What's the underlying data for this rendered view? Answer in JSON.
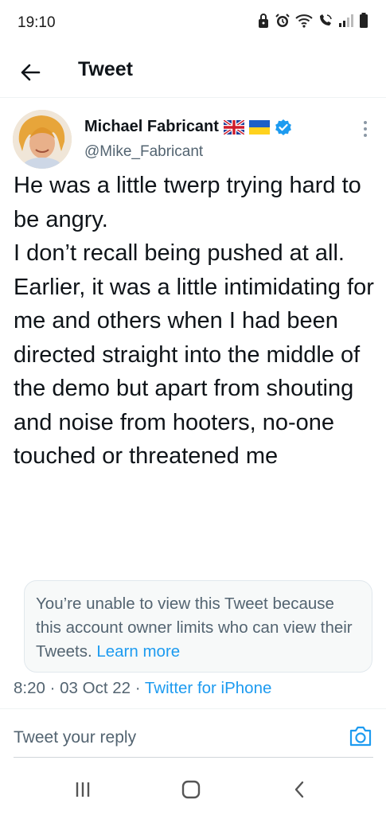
{
  "status_bar": {
    "time": "19:10",
    "icons": [
      "lock-icon",
      "alarm-icon",
      "wifi-icon",
      "wifi-calling-icon",
      "signal-icon",
      "battery-icon"
    ]
  },
  "nav": {
    "back_icon": "arrow-left-icon",
    "title": "Tweet"
  },
  "tweet": {
    "author": {
      "name": "Michael Fabricant",
      "handle": "@Mike_Fabricant",
      "badges": [
        "uk-flag-emoji",
        "ukraine-flag-emoji",
        "verified-badge-icon"
      ]
    },
    "text": "He was a little twerp trying hard to be angry.\nI don’t recall being pushed at all.\nEarlier, it was a little intimidating for me and others when I had been directed straight into the middle of the demo but apart from shouting and noise from hooters, no-one touched or threatened me",
    "quoted_notice": {
      "text": "You’re unable to view this Tweet because this account owner limits who can view their Tweets.",
      "link": "Learn more"
    },
    "time": "8:20",
    "date": "03 Oct 22",
    "source": "Twitter for iPhone",
    "separator": " · "
  },
  "reply": {
    "placeholder": "Tweet your reply",
    "camera_icon": "camera-icon"
  },
  "system_nav": [
    "recents-icon",
    "home-icon",
    "back-chevron-icon"
  ],
  "colors": {
    "accent": "#1d9bf0",
    "text": "#0f1419",
    "secondary": "#536471"
  }
}
